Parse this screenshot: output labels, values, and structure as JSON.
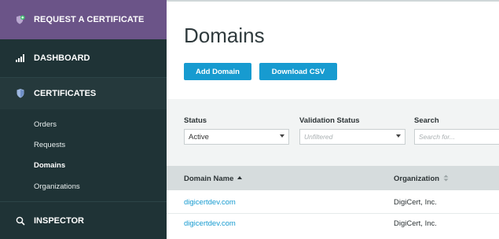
{
  "sidebar": {
    "request_label": "REQUEST A CERTIFICATE",
    "dashboard_label": "DASHBOARD",
    "certificates_label": "CERTIFICATES",
    "inspector_label": "INSPECTOR",
    "submenu": [
      "Orders",
      "Requests",
      "Domains",
      "Organizations"
    ],
    "active_submenu": "Domains"
  },
  "main": {
    "title": "Domains",
    "buttons": {
      "add": "Add Domain",
      "csv": "Download CSV"
    },
    "filters": {
      "status_label": "Status",
      "status_value": "Active",
      "validation_label": "Validation Status",
      "validation_placeholder": "Unfiltered",
      "search_label": "Search",
      "search_placeholder": "Search for..."
    },
    "table": {
      "columns": [
        "Domain Name",
        "Organization"
      ],
      "rows": [
        [
          "digicertdev.com",
          "DigiCert, Inc."
        ],
        [
          "digicertdev.com",
          "DigiCert, Inc."
        ]
      ]
    }
  },
  "colors": {
    "accent": "#179bd0",
    "sidebar_bg": "#1f3336",
    "request_bg": "#6b5488"
  }
}
